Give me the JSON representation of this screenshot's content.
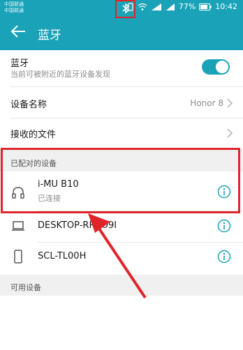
{
  "status_bar": {
    "carrier_1": "中国联通",
    "carrier_2": "中国联通",
    "battery": "77%",
    "time": "10:42"
  },
  "app_bar": {
    "title": "蓝牙",
    "back_icon": "arrow-left-icon"
  },
  "bluetooth_toggle": {
    "label": "蓝牙",
    "description": "当前可被附近的蓝牙设备发现",
    "enabled": true
  },
  "device_name": {
    "label": "设备名称",
    "value": "Honor 8"
  },
  "received_files": {
    "label": "接收的文件"
  },
  "paired_section": {
    "header": "已配对的设备",
    "devices": [
      {
        "name": "i-MU B10",
        "status": "已连接",
        "icon": "headphones-icon"
      },
      {
        "name": "DESKTOP-RRSO9I",
        "status": "",
        "icon": "laptop-icon"
      },
      {
        "name": "SCL-TL00H",
        "status": "",
        "icon": "phone-icon"
      }
    ]
  },
  "available_section": {
    "header": "可用设备"
  },
  "colors": {
    "accent": "#1aa3b8",
    "annotation": "#e0252a"
  }
}
